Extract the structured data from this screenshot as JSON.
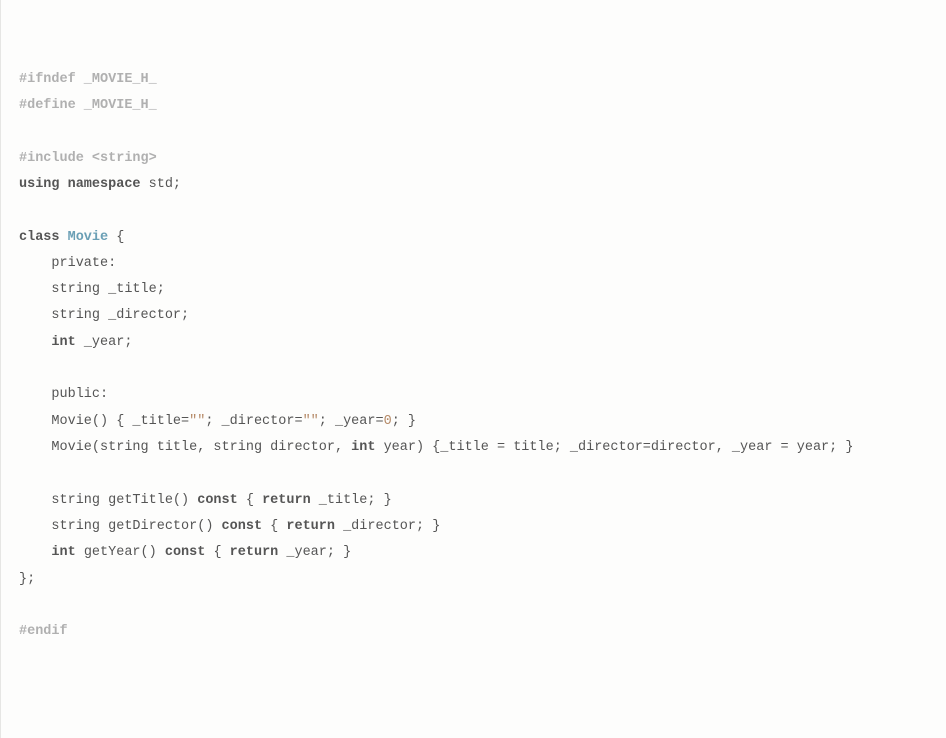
{
  "lines": [
    {
      "tokens": [
        {
          "text": "#ifndef _MOVIE_H_",
          "cls": "preproc"
        }
      ]
    },
    {
      "tokens": [
        {
          "text": "#define _MOVIE_H_",
          "cls": "preproc"
        }
      ]
    },
    {
      "tokens": [
        {
          "text": " ",
          "cls": "plain"
        }
      ]
    },
    {
      "tokens": [
        {
          "text": "#include <string>",
          "cls": "preproc"
        }
      ]
    },
    {
      "tokens": [
        {
          "text": "using namespace",
          "cls": "kw"
        },
        {
          "text": " std;",
          "cls": "plain"
        }
      ]
    },
    {
      "tokens": [
        {
          "text": " ",
          "cls": "plain"
        }
      ]
    },
    {
      "tokens": [
        {
          "text": "class ",
          "cls": "kw"
        },
        {
          "text": "Movie",
          "cls": "cls"
        },
        {
          "text": " {",
          "cls": "plain"
        }
      ]
    },
    {
      "tokens": [
        {
          "text": "    private:",
          "cls": "plain"
        }
      ]
    },
    {
      "tokens": [
        {
          "text": "    string _title;",
          "cls": "plain"
        }
      ]
    },
    {
      "tokens": [
        {
          "text": "    string _director;",
          "cls": "plain"
        }
      ]
    },
    {
      "tokens": [
        {
          "text": "    ",
          "cls": "plain"
        },
        {
          "text": "int",
          "cls": "kw"
        },
        {
          "text": " _year;",
          "cls": "plain"
        }
      ]
    },
    {
      "tokens": [
        {
          "text": " ",
          "cls": "plain"
        }
      ]
    },
    {
      "tokens": [
        {
          "text": "    public:",
          "cls": "plain"
        }
      ]
    },
    {
      "tokens": [
        {
          "text": "    Movie() { _title=",
          "cls": "plain"
        },
        {
          "text": "\"\"",
          "cls": "str"
        },
        {
          "text": "; _director=",
          "cls": "plain"
        },
        {
          "text": "\"\"",
          "cls": "str"
        },
        {
          "text": "; _year=",
          "cls": "plain"
        },
        {
          "text": "0",
          "cls": "num"
        },
        {
          "text": "; }",
          "cls": "plain"
        }
      ]
    },
    {
      "tokens": [
        {
          "text": "    Movie(string title, string director, ",
          "cls": "plain"
        },
        {
          "text": "int",
          "cls": "kw"
        },
        {
          "text": " year) {_title = title; _director=director, _year = year; }",
          "cls": "plain"
        }
      ]
    },
    {
      "tokens": [
        {
          "text": " ",
          "cls": "plain"
        }
      ]
    },
    {
      "tokens": [
        {
          "text": "    string getTitle() ",
          "cls": "plain"
        },
        {
          "text": "const",
          "cls": "kw"
        },
        {
          "text": " { ",
          "cls": "plain"
        },
        {
          "text": "return",
          "cls": "kw"
        },
        {
          "text": " _title; }",
          "cls": "plain"
        }
      ]
    },
    {
      "tokens": [
        {
          "text": "    string getDirector() ",
          "cls": "plain"
        },
        {
          "text": "const",
          "cls": "kw"
        },
        {
          "text": " { ",
          "cls": "plain"
        },
        {
          "text": "return",
          "cls": "kw"
        },
        {
          "text": " _director; }",
          "cls": "plain"
        }
      ]
    },
    {
      "tokens": [
        {
          "text": "    ",
          "cls": "plain"
        },
        {
          "text": "int",
          "cls": "kw"
        },
        {
          "text": " getYear() ",
          "cls": "plain"
        },
        {
          "text": "const",
          "cls": "kw"
        },
        {
          "text": " { ",
          "cls": "plain"
        },
        {
          "text": "return",
          "cls": "kw"
        },
        {
          "text": " _year; }",
          "cls": "plain"
        }
      ]
    },
    {
      "tokens": [
        {
          "text": "};",
          "cls": "plain"
        }
      ]
    },
    {
      "tokens": [
        {
          "text": " ",
          "cls": "plain"
        }
      ]
    },
    {
      "tokens": [
        {
          "text": "#endif",
          "cls": "preproc"
        }
      ]
    }
  ]
}
